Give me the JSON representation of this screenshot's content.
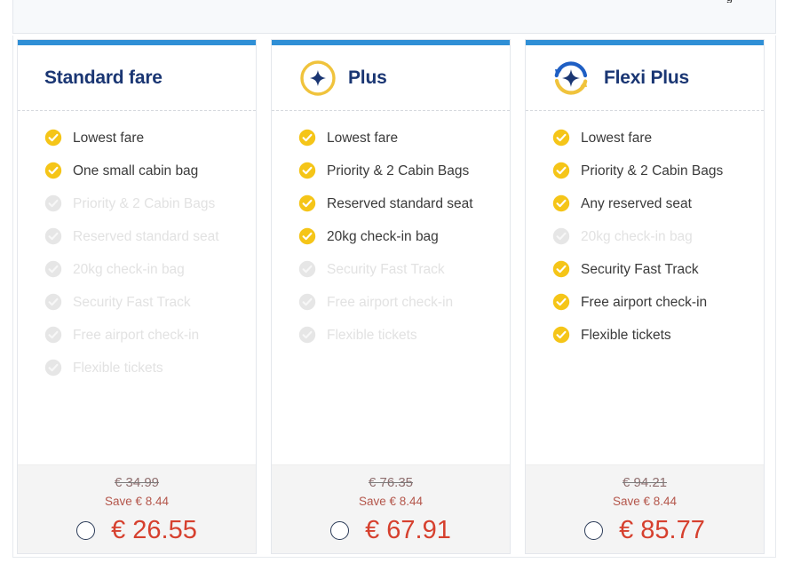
{
  "top_panel": {
    "clipped_text": "g"
  },
  "accent": {
    "card_top_bar": "#2f8fd6",
    "title": "#1a3673",
    "check_on": "#f5c518",
    "check_off": "#e6e6e6",
    "price": "#d6402e",
    "save": "#b4564b"
  },
  "cards": [
    {
      "id": "standard-fare",
      "title": "Standard fare",
      "icon": "none",
      "features": [
        {
          "label": "Lowest fare",
          "included": true
        },
        {
          "label": "One small cabin bag",
          "included": true
        },
        {
          "label": "Priority & 2 Cabin Bags",
          "included": false
        },
        {
          "label": "Reserved standard seat",
          "included": false
        },
        {
          "label": "20kg check-in bag",
          "included": false
        },
        {
          "label": "Security Fast Track",
          "included": false
        },
        {
          "label": "Free airport check-in",
          "included": false
        },
        {
          "label": "Flexible tickets",
          "included": false
        }
      ],
      "old_price": "€ 34.99",
      "save_text": "Save € 8.44",
      "price": "€ 26.55",
      "selected": false
    },
    {
      "id": "plus",
      "title": "Plus",
      "icon": "plus-circle-icon",
      "features": [
        {
          "label": "Lowest fare",
          "included": true
        },
        {
          "label": "Priority & 2 Cabin Bags",
          "included": true
        },
        {
          "label": "Reserved standard seat",
          "included": true
        },
        {
          "label": "20kg check-in bag",
          "included": true
        },
        {
          "label": "Security Fast Track",
          "included": false
        },
        {
          "label": "Free airport check-in",
          "included": false
        },
        {
          "label": "Flexible tickets",
          "included": false
        }
      ],
      "old_price": "€ 76.35",
      "save_text": "Save € 8.44",
      "price": "€ 67.91",
      "selected": false
    },
    {
      "id": "flexi-plus",
      "title": "Flexi Plus",
      "icon": "flexi-refresh-plus-icon",
      "features": [
        {
          "label": "Lowest fare",
          "included": true
        },
        {
          "label": "Priority & 2 Cabin Bags",
          "included": true
        },
        {
          "label": "Any reserved seat",
          "included": true
        },
        {
          "label": "20kg check-in bag",
          "included": false
        },
        {
          "label": "Security Fast Track",
          "included": true
        },
        {
          "label": "Free airport check-in",
          "included": true
        },
        {
          "label": "Flexible tickets",
          "included": true
        }
      ],
      "old_price": "€ 94.21",
      "save_text": "Save € 8.44",
      "price": "€ 85.77",
      "selected": false
    }
  ]
}
